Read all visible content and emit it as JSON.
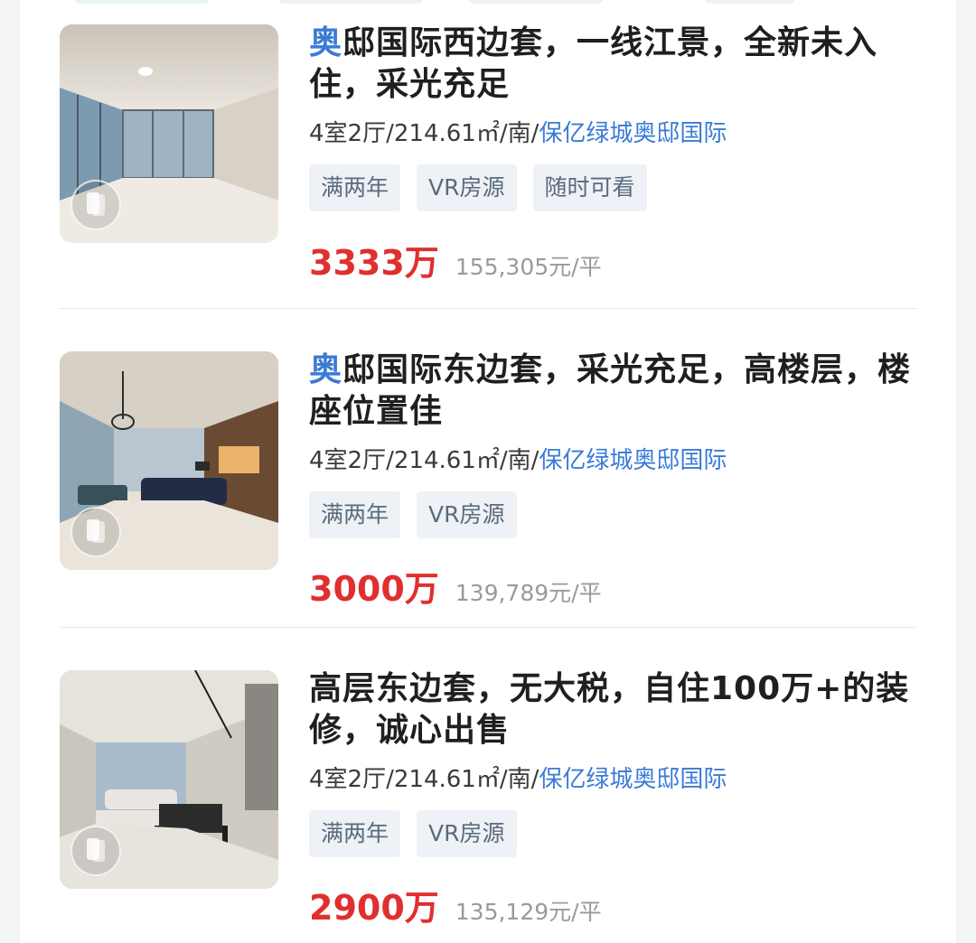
{
  "listings": [
    {
      "title_highlight": "奥",
      "title_rest": "邸国际西边套，一线江景，全新未入住，采光充足",
      "layout": "4室2厅",
      "area": "214.61㎡",
      "orientation": "南",
      "community": "保亿绿城奥邸国际",
      "tags": [
        "满两年",
        "VR房源",
        "随时可看"
      ],
      "price": "3333万",
      "unit_price": "155,305元/平"
    },
    {
      "title_highlight": "奥",
      "title_rest": "邸国际东边套，采光充足，高楼层，楼座位置佳",
      "layout": "4室2厅",
      "area": "214.61㎡",
      "orientation": "南",
      "community": "保亿绿城奥邸国际",
      "tags": [
        "满两年",
        "VR房源"
      ],
      "price": "3000万",
      "unit_price": "139,789元/平"
    },
    {
      "title_highlight": "",
      "title_rest": "高层东边套，无大税，自住100万+的装修，诚心出售",
      "layout": "4室2厅",
      "area": "214.61㎡",
      "orientation": "南",
      "community": "保亿绿城奥邸国际",
      "tags": [
        "满两年",
        "VR房源"
      ],
      "price": "2900万",
      "unit_price": "135,129元/平"
    }
  ],
  "separator": "/",
  "colors": {
    "price": "#e02f2f",
    "link": "#3a7bd5",
    "tag_bg": "#eef2f6",
    "tag_text": "#5b6b7d"
  },
  "icons": {
    "vr_badge": "vr-panorama-icon"
  }
}
